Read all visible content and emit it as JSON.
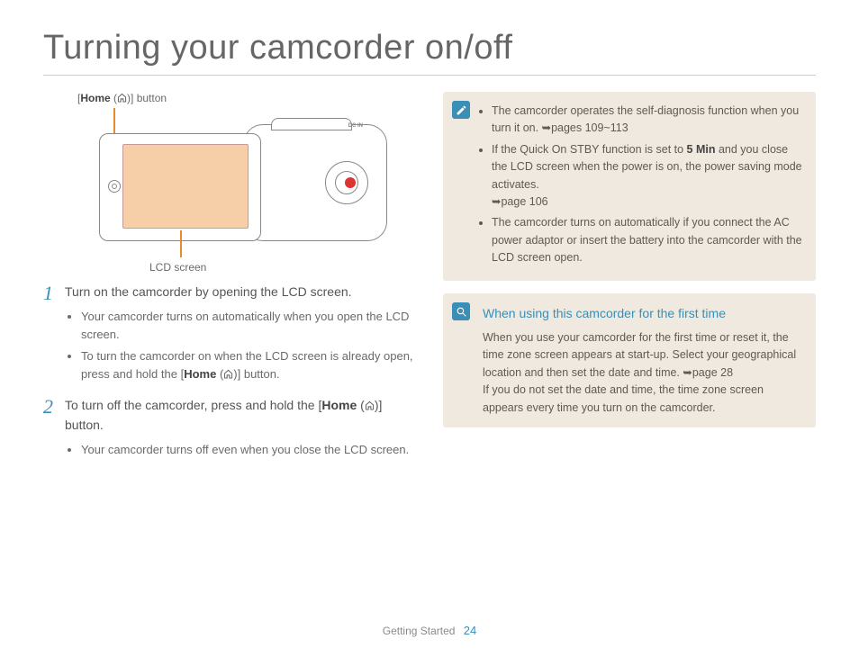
{
  "title": "Turning your camcorder on/off",
  "diagram": {
    "home_label_pre": "[",
    "home_label_bold": "Home",
    "home_label_post": " (        )] button",
    "lcd_label": "LCD screen",
    "dcin": "DC IN"
  },
  "steps": [
    {
      "num": "1",
      "lead_pre": "Turn on the camcorder by opening the LCD screen.",
      "bullets": [
        "Your camcorder turns on automatically when you open the LCD screen.",
        "To turn the camcorder on when the LCD screen is already open, press and hold the [Home (⌂)] button."
      ]
    },
    {
      "num": "2",
      "lead_pre": "To turn off the camcorder, press and hold the [",
      "lead_bold": "Home",
      "lead_post": " (⌂)] button.",
      "bullets": [
        "Your camcorder turns off even when you close the LCD screen."
      ]
    }
  ],
  "notes1": {
    "items": [
      {
        "pre": "The camcorder operates the self-diagnosis function when you turn it on. ",
        "ref": "➥pages 109~113"
      },
      {
        "pre": "If the Quick On STBY function is set to ",
        "bold": "5 Min",
        "post": " and you close the LCD screen when the power is on, the power saving mode activates. ",
        "ref": "➥page 106"
      },
      {
        "pre": "The camcorder turns on automatically if you connect the AC power adaptor or insert the battery into the camcorder with the LCD screen open."
      }
    ]
  },
  "notes2": {
    "heading": "When using this camcorder for the first time",
    "p1": "When you use your camcorder for the first time or reset it, the time zone screen appears at start-up. Select your geographical location and then set the date and time. ➥page 28",
    "p2": "If you do not set the date and time, the time zone screen appears every time you turn on the camcorder."
  },
  "footer": {
    "section": "Getting Started",
    "page": "24"
  }
}
